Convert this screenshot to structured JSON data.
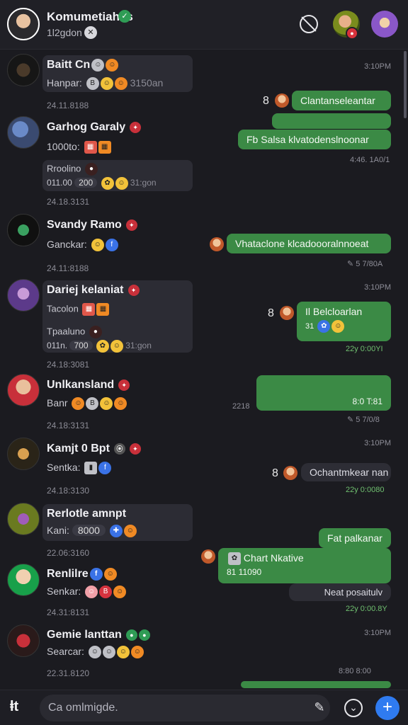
{
  "header": {
    "title": "Komumetiahas",
    "subtitle": "1l2gdon",
    "title_badge": "✓",
    "subtitle_icon": "✕"
  },
  "rows": [
    {
      "name": "Baitt Cn",
      "line1": "Hanpar:",
      "line1_tail": "3150an",
      "date": "24.11.8188",
      "right_time": "3:10PM",
      "right_bubble_1": "Clantanseleantar",
      "right_bubble_2": "Fb Salsa klvatodenslnoonar",
      "right_time_2": "4:46. 1A0/1",
      "right_num": "8"
    },
    {
      "name": "Garhog Garaly",
      "line1": "1000to:",
      "line2": "Rroolino",
      "line3_prefix": "011.00",
      "line3_val": "200",
      "line3_tail": "31:gon",
      "date": "24.18.3131"
    },
    {
      "name": "Svandy Ramo",
      "line1": "Ganckar:",
      "date": "24.11:8188",
      "right_bubble": "Vhataclone klcadoooralnnoeat",
      "right_time": "5 7/80A"
    },
    {
      "name": "Dariej kelaniat",
      "line1": "Tacolon",
      "line2": "Tpaaluno",
      "line3_prefix": "011n.",
      "line3_val": "700",
      "line3_tail": "31:gon",
      "date": "24.18:3081",
      "right_time": "3:10PM",
      "right_num": "8",
      "right_bubble": "Il Belcloarlan",
      "right_bubble_sub": "31",
      "right_time_2": "22y 0:00YI"
    },
    {
      "name": "Unlkansland",
      "line1": "Banr",
      "date": "24.18:3131",
      "left_time": "2218",
      "right_bubble_val": "8:0 T:81",
      "right_time": "5 7/0/8"
    },
    {
      "name": "Kamjt 0 Bpt",
      "line1": "Sentka:",
      "date": "24.18:3130",
      "right_time": "3:10PM",
      "right_num": "8",
      "right_bubble": "Ochantmkear nan",
      "right_time_2": "22y 0:0080"
    },
    {
      "name": "Rerlotle amnpt",
      "line1": "Kani:",
      "line1_val": "8000",
      "date": "22.06:3160",
      "right_bubble_1": "Fat palkanar",
      "right_bubble_2_title": "Chart Nkative",
      "right_bubble_2_val": "81 11090",
      "right_bubble_3": "Neat posaitulv"
    },
    {
      "name": "Renlilre",
      "line1": "Senkar:",
      "date": "24.31:8131",
      "right_time": "22y 0:00.8Y"
    },
    {
      "name": "Gemie lanttan",
      "line1": "Searcar:",
      "date": "22.31.8120",
      "right_time": "3:10PM",
      "right_time_2": "8:80 8:00"
    }
  ],
  "composer": {
    "placeholder": "Ca omlmigde.",
    "left_icon": "ⱡt"
  },
  "icons": {
    "block": "block-icon",
    "send": "plus-icon",
    "pen": "pen-icon",
    "chevron": "chevron-down-icon"
  },
  "colors": {
    "accent_green": "#3b8a45",
    "accent_blue": "#2f7bf0",
    "badge_red": "#c8303a"
  }
}
